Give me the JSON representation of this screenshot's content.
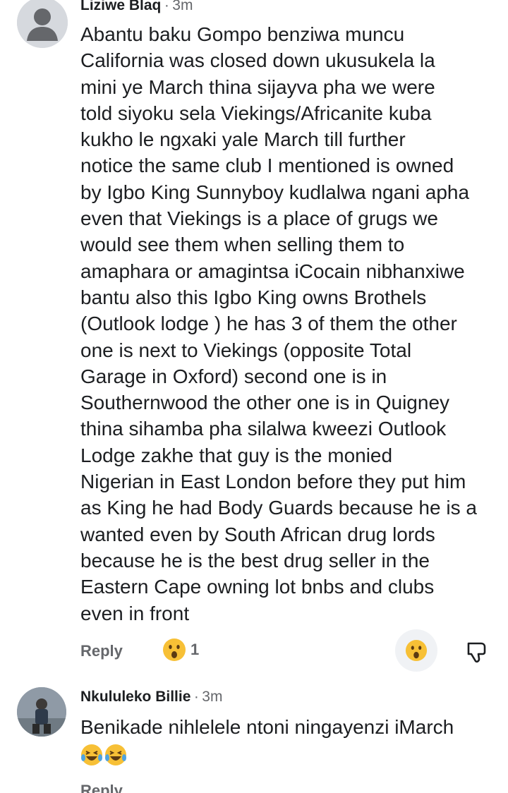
{
  "comments": [
    {
      "author": "Liziwe Blaq",
      "separator": "·",
      "time": "3m",
      "body": "Abantu baku Gompo benziwa muncu\nCalifornia was closed down ukusukela la\nmini ye March thina sijayva pha we were\ntold siyoku sela Viekings/Africanite kuba\nkukho le ngxaki yale March till further\nnotice the same club I mentioned is owned\nby Igbo King Sunnyboy kudlalwa ngani apha\neven that Viekings is a place of grugs we\nwould see them when selling them to\namaphara or amagintsa iCocain nibhanxiwe\nbantu  also this Igbo King owns Brothels\n(Outlook lodge ) he has 3 of them the other\none is next to Viekings (opposite Total\nGarage in Oxford) second one is in\nSouthernwood the other one is in Quigney\nthina sihamba pha silalwa kweezi Outlook\nLodge zakhe that guy is the monied\nNigerian in East London before they put him\nas King he had Body Guards because he is a\nwanted even by South African drug lords\nbecause he is the best drug seller in the\nEastern Cape owning lot bnbs and clubs\neven in front",
      "reply_label": "Reply",
      "reaction_icon": "wow-emoji-icon",
      "reaction_count": "1"
    },
    {
      "author": "Nkululeko Billie",
      "separator": "·",
      "time": "3m",
      "body": "Benikade nihlelele ntoni ningayenzi iMarch",
      "emoji_icons": [
        "laughing-tears-emoji-icon",
        "laughing-tears-emoji-icon"
      ],
      "reply_label": "Reply"
    }
  ],
  "colors": {
    "text": "#1c1e21",
    "secondary": "#65676b",
    "emoji_yellow": "#f7c036",
    "button_bg": "#f0f2f5"
  }
}
